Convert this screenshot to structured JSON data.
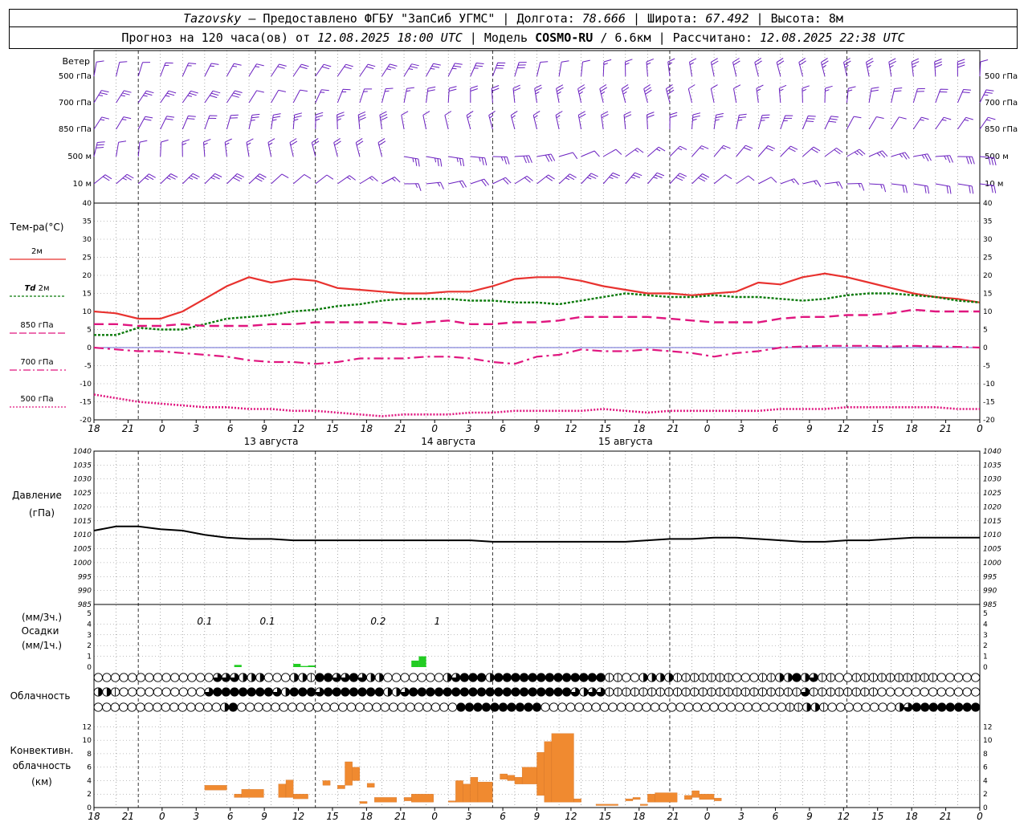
{
  "header": {
    "station": "Tazovsky",
    "provider": " — Предоставлено ФГБУ \"ЗапСиб УГМС\" | Долгота: ",
    "lon": "78.666",
    "lat_label": " | Широта: ",
    "lat": "67.492",
    "alt_label": " | Высота: ",
    "alt": "8м",
    "forecast_label": "Прогноз на 120 часа(ов) от ",
    "forecast_from": "12.08.2025 18:00 UTC",
    "model_label": " | Модель ",
    "model": "COSMO-RU",
    "model_res": " / 6.6км",
    "calc_label": " | Рассчитано: ",
    "calc_time": "12.08.2025 22:38 UTC"
  },
  "labels": {
    "wind": "Ветер",
    "wind_levels": [
      "500 гПа",
      "700 гПа",
      "850 гПа",
      "500 м",
      "10  м"
    ],
    "temp": "Тем-ра(°C)",
    "t2m": "2м",
    "td_prefix": "Td",
    "td2m": " 2м",
    "t850": "850 гПа",
    "t700": "700 гПа",
    "t500": "500 гПа",
    "pressure": "Давление",
    "pressure_unit": "(гПа)",
    "precip_unit3": "(мм/3ч.)",
    "precip": "Осадки",
    "precip_unit1": "(мм/1ч.)",
    "cloud": "Облачность",
    "conv1": "Конвективн.",
    "conv2": "облачность",
    "conv3": "(км)"
  },
  "colors": {
    "t2m": "#e8322f",
    "td": "#0a7a0a",
    "t850": "#e0167f",
    "t700": "#e0167f",
    "t500": "#e0167f",
    "wind": "#6a1fc0",
    "pressure": "#000000",
    "precip": "#22cc22",
    "conv": "#f08a30"
  },
  "chart_data": {
    "type": "line",
    "time_ticks": [
      "18",
      "21",
      "0",
      "3",
      "6",
      "9",
      "12",
      "15",
      "18",
      "21",
      "0",
      "3",
      "6",
      "9",
      "12",
      "15",
      "18",
      "21",
      "0",
      "3",
      "6",
      "9",
      "12",
      "15",
      "18",
      "21",
      "0"
    ],
    "date_labels": [
      {
        "label": "13 августа",
        "hour": 24
      },
      {
        "label": "14 августа",
        "hour": 48
      },
      {
        "label": "15 августа",
        "hour": 72
      }
    ],
    "temperature": {
      "ylim": [
        -20,
        40
      ],
      "ticks": [
        -20,
        -15,
        -10,
        -5,
        0,
        5,
        10,
        15,
        20,
        25,
        30,
        35,
        40
      ],
      "series": [
        {
          "name": "2м",
          "x": [
            0,
            3,
            6,
            9,
            12,
            15,
            18,
            21,
            24,
            27,
            30,
            33,
            36,
            39,
            42,
            45,
            48,
            51,
            54,
            57,
            60,
            63,
            66,
            69,
            72,
            75,
            78,
            81,
            84,
            87,
            90,
            93,
            96,
            99,
            102,
            105,
            108,
            111,
            114,
            117,
            120
          ],
          "values": [
            10,
            9.5,
            8,
            8,
            10,
            13.5,
            17,
            19.5,
            18,
            19,
            18.5,
            16.5,
            16,
            15.5,
            15,
            15,
            15.5,
            15.5,
            17,
            19,
            19.5,
            19.5,
            18.5,
            17,
            16,
            15,
            15,
            14.5,
            15,
            15.5,
            18,
            17.5,
            19.5,
            20.5,
            19.5,
            18,
            16.5,
            15,
            14,
            13.5,
            12.5
          ]
        },
        {
          "name": "Td 2м",
          "x": [
            0,
            3,
            6,
            9,
            12,
            15,
            18,
            21,
            24,
            27,
            30,
            33,
            36,
            39,
            42,
            45,
            48,
            51,
            54,
            57,
            60,
            63,
            66,
            69,
            72,
            75,
            78,
            81,
            84,
            87,
            90,
            93,
            96,
            99,
            102,
            105,
            108,
            111,
            114,
            117,
            120
          ],
          "values": [
            3.5,
            3.5,
            5.5,
            5,
            5,
            6.5,
            8,
            8.5,
            9,
            10,
            10.5,
            11.5,
            12,
            13,
            13.5,
            13.5,
            13.5,
            13,
            13,
            12.5,
            12.5,
            12,
            13,
            14,
            15,
            14.5,
            14,
            14,
            14.5,
            14,
            14,
            13.5,
            13,
            13.5,
            14.5,
            15,
            15,
            14.5,
            14,
            13,
            12.5
          ]
        },
        {
          "name": "850 гПа",
          "x": [
            0,
            3,
            6,
            9,
            12,
            15,
            18,
            21,
            24,
            27,
            30,
            33,
            36,
            39,
            42,
            45,
            48,
            51,
            54,
            57,
            60,
            63,
            66,
            69,
            72,
            75,
            78,
            81,
            84,
            87,
            90,
            93,
            96,
            99,
            102,
            105,
            108,
            111,
            114,
            117,
            120
          ],
          "values": [
            6.5,
            6.5,
            6,
            6,
            6.5,
            6,
            6,
            6,
            6.5,
            6.5,
            7,
            7,
            7,
            7,
            6.5,
            7,
            7.5,
            6.5,
            6.5,
            7,
            7,
            7.5,
            8.5,
            8.5,
            8.5,
            8.5,
            8,
            7.5,
            7,
            7,
            7,
            8,
            8.5,
            8.5,
            9,
            9,
            9.5,
            10.5,
            10,
            10,
            10
          ]
        },
        {
          "name": "700 гПа",
          "x": [
            0,
            3,
            6,
            9,
            12,
            15,
            18,
            21,
            24,
            27,
            30,
            33,
            36,
            39,
            42,
            45,
            48,
            51,
            54,
            57,
            60,
            63,
            66,
            69,
            72,
            75,
            78,
            81,
            84,
            87,
            90,
            93,
            96,
            99,
            102,
            105,
            108,
            111,
            114,
            117,
            120
          ],
          "values": [
            0,
            -0.5,
            -1,
            -1,
            -1.5,
            -2,
            -2.5,
            -3.5,
            -4,
            -4,
            -4.5,
            -4,
            -3,
            -3,
            -3,
            -2.5,
            -2.5,
            -3,
            -4,
            -4.5,
            -2.5,
            -2,
            -0.5,
            -1,
            -1,
            -0.5,
            -1,
            -1.5,
            -2.5,
            -1.5,
            -1,
            0,
            0.3,
            0.5,
            0.5,
            0.5,
            0.3,
            0.5,
            0.3,
            0.2,
            0
          ]
        },
        {
          "name": "500 гПа",
          "x": [
            0,
            3,
            6,
            9,
            12,
            15,
            18,
            21,
            24,
            27,
            30,
            33,
            36,
            39,
            42,
            45,
            48,
            51,
            54,
            57,
            60,
            63,
            66,
            69,
            72,
            75,
            78,
            81,
            84,
            87,
            90,
            93,
            96,
            99,
            102,
            105,
            108,
            111,
            114,
            117,
            120
          ],
          "values": [
            -13,
            -14,
            -15,
            -15.5,
            -16,
            -16.5,
            -16.5,
            -17,
            -17,
            -17.5,
            -17.5,
            -18,
            -18.5,
            -19,
            -18.5,
            -18.5,
            -18.5,
            -18,
            -18,
            -17.5,
            -17.5,
            -17.5,
            -17.5,
            -17,
            -17.5,
            -18,
            -17.5,
            -17.5,
            -17.5,
            -17.5,
            -17.5,
            -17,
            -17,
            -17,
            -16.5,
            -16.5,
            -16.5,
            -16.5,
            -16.5,
            -17,
            -17
          ]
        }
      ]
    },
    "pressure": {
      "ylim": [
        985,
        1040
      ],
      "ticks": [
        985,
        990,
        995,
        1000,
        1005,
        1010,
        1015,
        1020,
        1025,
        1030,
        1035,
        1040
      ],
      "x": [
        0,
        3,
        6,
        9,
        12,
        15,
        18,
        21,
        24,
        27,
        30,
        33,
        36,
        39,
        42,
        45,
        48,
        51,
        54,
        57,
        60,
        63,
        66,
        69,
        72,
        75,
        78,
        81,
        84,
        87,
        90,
        93,
        96,
        99,
        102,
        105,
        108,
        111,
        114,
        117,
        120
      ],
      "values": [
        1011.5,
        1013,
        1013,
        1012,
        1011.5,
        1010,
        1009,
        1008.5,
        1008.5,
        1008,
        1008,
        1008,
        1008,
        1008,
        1008,
        1008,
        1008,
        1008,
        1007.5,
        1007.5,
        1007.5,
        1007.5,
        1007.5,
        1007.5,
        1007.5,
        1008,
        1008.5,
        1008.5,
        1009,
        1009,
        1008.5,
        1008,
        1007.5,
        1007.5,
        1008,
        1008,
        1008.5,
        1009,
        1009,
        1009,
        1009
      ]
    },
    "precipitation": {
      "ylim": [
        0,
        5
      ],
      "ticks": [
        0,
        1,
        2,
        3,
        4,
        5
      ],
      "x": [
        19,
        28,
        27,
        29,
        43,
        44
      ],
      "values": [
        0.2,
        0.1,
        0.3,
        0.15,
        0.6,
        1.0
      ],
      "sums3h": [
        {
          "label": "0.1",
          "hour": 15
        },
        {
          "label": "0.1",
          "hour": 23.5
        },
        {
          "label": "0.2",
          "hour": 38.5
        },
        {
          "label": "1",
          "hour": 46.5
        }
      ]
    },
    "cloudiness": {
      "rows": 3,
      "levels_note": "0 clear, 1 quarter, 2 half, 3 three-quarter, 4 overcast",
      "low": [
        0,
        0,
        0,
        0,
        0,
        0,
        0,
        0,
        0,
        0,
        0,
        0,
        0,
        0,
        3,
        3,
        3,
        2,
        2,
        2,
        0,
        0,
        0,
        2,
        2,
        1,
        4,
        4,
        3,
        3,
        4,
        3,
        2,
        2,
        0,
        0,
        0,
        0,
        0,
        0,
        0,
        2,
        3,
        4,
        4,
        4,
        2,
        4,
        4,
        4,
        4,
        4,
        4,
        4,
        4,
        4,
        4,
        4,
        4,
        4,
        1,
        1,
        0,
        0,
        2,
        2,
        2,
        2,
        1,
        1,
        1,
        1,
        1,
        1,
        1,
        0,
        0,
        0,
        1,
        1,
        2,
        2,
        4,
        2,
        3,
        1,
        1,
        0,
        0,
        1,
        1,
        1,
        1,
        1,
        1,
        1,
        1,
        1,
        1,
        0,
        0,
        0,
        0,
        0
      ],
      "mid": [
        2,
        2,
        1,
        0,
        0,
        0,
        0,
        0,
        0,
        0,
        0,
        0,
        0,
        3,
        4,
        4,
        4,
        4,
        4,
        4,
        4,
        3,
        2,
        4,
        4,
        4,
        3,
        4,
        4,
        4,
        4,
        4,
        4,
        4,
        2,
        2,
        3,
        4,
        4,
        4,
        4,
        4,
        4,
        4,
        4,
        4,
        4,
        4,
        4,
        4,
        4,
        4,
        4,
        4,
        4,
        4,
        3,
        2,
        3,
        3,
        1,
        1,
        1,
        1,
        1,
        1,
        1,
        1,
        1,
        1,
        1,
        1,
        1,
        1,
        1,
        1,
        1,
        1,
        1,
        1,
        1,
        1,
        1,
        3,
        1,
        1,
        1,
        1,
        1,
        1,
        1,
        1,
        0,
        0,
        0,
        0,
        0,
        0,
        0,
        0,
        0,
        0,
        0,
        0
      ],
      "high": [
        0,
        0,
        0,
        0,
        0,
        0,
        0,
        0,
        0,
        0,
        0,
        0,
        0,
        0,
        0,
        2,
        4,
        0,
        0,
        0,
        0,
        0,
        0,
        0,
        0,
        0,
        0,
        0,
        0,
        0,
        0,
        0,
        0,
        0,
        0,
        0,
        0,
        0,
        0,
        0,
        0,
        0,
        0,
        4,
        4,
        4,
        4,
        4,
        4,
        4,
        4,
        4,
        4,
        0,
        0,
        0,
        0,
        0,
        0,
        0,
        0,
        0,
        0,
        0,
        0,
        0,
        0,
        0,
        0,
        0,
        0,
        0,
        0,
        0,
        0,
        0,
        0,
        0,
        0,
        0,
        0,
        0,
        1,
        1,
        2,
        2,
        1,
        0,
        0,
        0,
        0,
        0,
        0,
        0,
        0,
        2,
        3,
        4,
        4,
        4,
        4,
        4,
        4,
        4,
        4
      ]
    },
    "convective": {
      "ylim": [
        0,
        13
      ],
      "ticks": [
        0,
        2,
        4,
        6,
        8,
        10,
        12
      ],
      "bars": [
        {
          "x0": 15,
          "x1": 18,
          "bottom": 2.6,
          "top": 3.3
        },
        {
          "x0": 19,
          "x1": 20,
          "bottom": 1.5,
          "top": 2.0
        },
        {
          "x0": 20,
          "x1": 23,
          "bottom": 1.5,
          "top": 2.7
        },
        {
          "x0": 25,
          "x1": 26,
          "bottom": 1.5,
          "top": 3.5
        },
        {
          "x0": 26,
          "x1": 27,
          "bottom": 1.5,
          "top": 4.1
        },
        {
          "x0": 27,
          "x1": 29,
          "bottom": 1.3,
          "top": 2.0
        },
        {
          "x0": 31,
          "x1": 32,
          "bottom": 3.3,
          "top": 4.0
        },
        {
          "x0": 33,
          "x1": 34,
          "bottom": 2.8,
          "top": 3.3
        },
        {
          "x0": 34,
          "x1": 35,
          "bottom": 3.3,
          "top": 6.8
        },
        {
          "x0": 35,
          "x1": 36,
          "bottom": 4.0,
          "top": 6.0
        },
        {
          "x0": 36,
          "x1": 37,
          "bottom": 0.6,
          "top": 0.9
        },
        {
          "x0": 37,
          "x1": 38,
          "bottom": 3.0,
          "top": 3.6
        },
        {
          "x0": 38,
          "x1": 41,
          "bottom": 0.8,
          "top": 1.5
        },
        {
          "x0": 42,
          "x1": 43,
          "bottom": 1.0,
          "top": 1.5
        },
        {
          "x0": 43,
          "x1": 46,
          "bottom": 0.8,
          "top": 2.0
        },
        {
          "x0": 48,
          "x1": 49,
          "bottom": 0.8,
          "top": 1.0
        },
        {
          "x0": 49,
          "x1": 50,
          "bottom": 0.8,
          "top": 4.0
        },
        {
          "x0": 50,
          "x1": 51,
          "bottom": 0.8,
          "top": 3.5
        },
        {
          "x0": 51,
          "x1": 52,
          "bottom": 0.8,
          "top": 4.5
        },
        {
          "x0": 52,
          "x1": 54,
          "bottom": 0.8,
          "top": 3.8
        },
        {
          "x0": 55,
          "x1": 56,
          "bottom": 4.2,
          "top": 5.0
        },
        {
          "x0": 56,
          "x1": 57,
          "bottom": 4.0,
          "top": 4.8
        },
        {
          "x0": 57,
          "x1": 58,
          "bottom": 3.5,
          "top": 4.5
        },
        {
          "x0": 58,
          "x1": 60,
          "bottom": 3.5,
          "top": 6.0
        },
        {
          "x0": 60,
          "x1": 61,
          "bottom": 1.8,
          "top": 8.2
        },
        {
          "x0": 61,
          "x1": 62,
          "bottom": 0.8,
          "top": 9.8
        },
        {
          "x0": 62,
          "x1": 65,
          "bottom": 0.8,
          "top": 11.0
        },
        {
          "x0": 65,
          "x1": 66,
          "bottom": 0.8,
          "top": 1.3
        },
        {
          "x0": 68,
          "x1": 71,
          "bottom": 0.3,
          "top": 0.5
        },
        {
          "x0": 72,
          "x1": 73,
          "bottom": 1.0,
          "top": 1.3
        },
        {
          "x0": 73,
          "x1": 74,
          "bottom": 1.2,
          "top": 1.5
        },
        {
          "x0": 74,
          "x1": 75,
          "bottom": 0.3,
          "top": 0.5
        },
        {
          "x0": 75,
          "x1": 76,
          "bottom": 0.8,
          "top": 2.0
        },
        {
          "x0": 76,
          "x1": 79,
          "bottom": 0.8,
          "top": 2.2
        },
        {
          "x0": 80,
          "x1": 81,
          "bottom": 1.2,
          "top": 1.8
        },
        {
          "x0": 81,
          "x1": 82,
          "bottom": 1.5,
          "top": 2.5
        },
        {
          "x0": 82,
          "x1": 84,
          "bottom": 1.2,
          "top": 2.0
        },
        {
          "x0": 84,
          "x1": 85,
          "bottom": 1.0,
          "top": 1.4
        }
      ]
    }
  }
}
